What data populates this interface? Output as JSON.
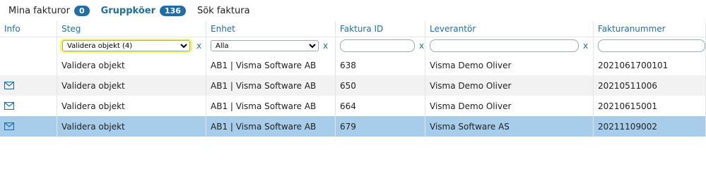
{
  "tabs": [
    {
      "label": "Mina fakturor",
      "count": "0"
    },
    {
      "label": "Gruppköer",
      "count": "136"
    },
    {
      "label": "Sök faktura",
      "count": ""
    }
  ],
  "columns": [
    "Info",
    "Steg",
    "Enhet",
    "Faktura ID",
    "Leverantör",
    "Fakturanummer"
  ],
  "filters": {
    "steg": "Validera objekt (4)",
    "enhet": "Alla",
    "clear": "x"
  },
  "rows": [
    {
      "info": "",
      "steg": "Validera objekt",
      "enhet": "AB1 | Visma Software AB",
      "faktura_id": "638",
      "leverantor": "Visma Demo Oliver",
      "fakturanummer": "2021061700101"
    },
    {
      "info": "mail",
      "steg": "Validera objekt",
      "enhet": "AB1 | Visma Software AB",
      "faktura_id": "650",
      "leverantor": "Visma Demo Oliver",
      "fakturanummer": "20210511006"
    },
    {
      "info": "mail",
      "steg": "Validera objekt",
      "enhet": "AB1 | Visma Software AB",
      "faktura_id": "664",
      "leverantor": "Visma Demo Oliver",
      "fakturanummer": "20210615001"
    },
    {
      "info": "mail",
      "steg": "Validera objekt",
      "enhet": "AB1 | Visma Software AB",
      "faktura_id": "679",
      "leverantor": "Visma Software AS",
      "fakturanummer": "20211109002"
    }
  ],
  "colors": {
    "accent": "#1f6fa6",
    "selected_row": "#a8cdea",
    "highlight": "#f7f55a"
  }
}
